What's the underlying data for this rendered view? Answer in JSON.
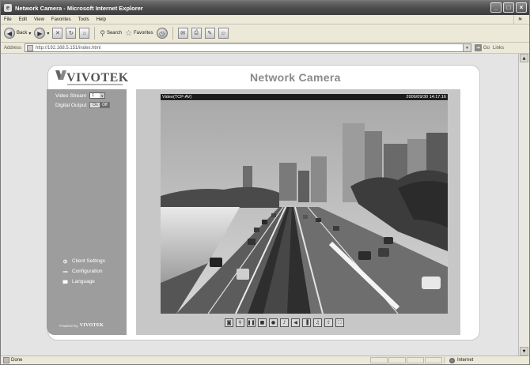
{
  "browser": {
    "title": "Network Camera - Microsoft Internet Explorer",
    "menu": [
      "File",
      "Edit",
      "View",
      "Favorites",
      "Tools",
      "Help"
    ],
    "toolbar": {
      "back_label": "Back",
      "search_label": "Search",
      "favorites_label": "Favorites"
    },
    "address": {
      "label": "Address",
      "url": "http://192.168.5.151/index.html",
      "go_label": "Go",
      "links_label": "Links"
    },
    "status": {
      "text": "Done",
      "zone": "Internet"
    }
  },
  "camera_page": {
    "brand": "VIVOTEK",
    "title": "Network Camera",
    "sidebar": {
      "video_stream_label": "Video Stream",
      "video_stream_value": "1",
      "digital_output_label": "Digital Output",
      "digital_output_on": "On",
      "digital_output_off": "Off",
      "links": [
        {
          "label": "Client Settings",
          "icon": "client-settings-icon"
        },
        {
          "label": "Configuration",
          "icon": "configuration-icon"
        },
        {
          "label": "Language",
          "icon": "language-icon"
        }
      ],
      "powered_by": "Powered by",
      "powered_brand": "VIVOTEK"
    },
    "video": {
      "stream_name": "Video(TCP-AV)",
      "timestamp": "2006/09/30 14:17:16"
    },
    "controls": [
      "snapshot-icon",
      "zoom-icon",
      "pause-icon",
      "stop-icon",
      "record-icon",
      "volume-icon",
      "mute-icon",
      "talk-icon",
      "mic-icon",
      "upload-icon",
      "fullscreen-icon"
    ]
  }
}
